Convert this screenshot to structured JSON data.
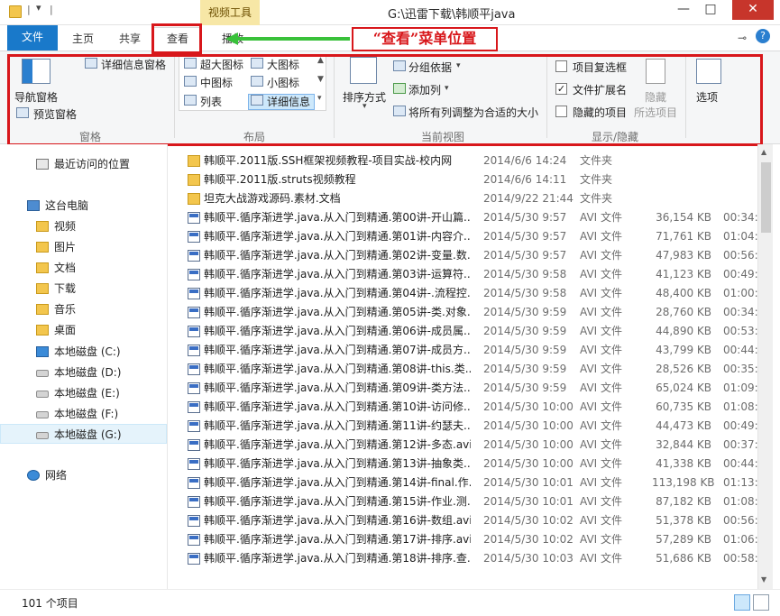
{
  "window": {
    "title": "G:\\迅雷下载\\韩顺平java",
    "context_tab": "视频工具",
    "controls": [
      "—",
      "□",
      "✕"
    ]
  },
  "ribbon_tabs": [
    "文件",
    "主页",
    "共享",
    "查看",
    "播放"
  ],
  "annotation": "“查看”菜单位置",
  "ribbon": {
    "panes": {
      "nav_pane": "导航窗格",
      "preview_pane": "预览窗格",
      "details_pane": "详细信息窗格",
      "label": "窗格"
    },
    "layout": {
      "items": [
        "超大图标",
        "大图标",
        "中图标",
        "小图标",
        "列表",
        "详细信息"
      ],
      "label": "布局"
    },
    "current_view": {
      "sort_by": "排序方式",
      "group_by": "分组依据",
      "add_columns": "添加列",
      "fit_columns": "将所有列调整为合适的大小",
      "label": "当前视图"
    },
    "show_hide": {
      "item_checkboxes": "项目复选框",
      "file_extensions": "文件扩展名",
      "hidden_items": "隐藏的项目",
      "hide": "隐藏",
      "selected_items": "所选项目",
      "label": "显示/隐藏"
    },
    "options": "选项"
  },
  "nav": {
    "items": [
      {
        "label": "最近访问的位置",
        "icon": "recent-places-icon"
      },
      {
        "label": "这台电脑",
        "icon": "this-pc-icon"
      },
      {
        "label": "视频",
        "icon": "folder-icon"
      },
      {
        "label": "图片",
        "icon": "folder-icon"
      },
      {
        "label": "文档",
        "icon": "folder-icon"
      },
      {
        "label": "下载",
        "icon": "folder-icon"
      },
      {
        "label": "音乐",
        "icon": "folder-icon"
      },
      {
        "label": "桌面",
        "icon": "folder-icon"
      },
      {
        "label": "本地磁盘 (C:)",
        "icon": "system-drive-icon"
      },
      {
        "label": "本地磁盘 (D:)",
        "icon": "drive-icon"
      },
      {
        "label": "本地磁盘 (E:)",
        "icon": "drive-icon"
      },
      {
        "label": "本地磁盘 (F:)",
        "icon": "drive-icon"
      },
      {
        "label": "本地磁盘 (G:)",
        "icon": "drive-icon"
      },
      {
        "label": "网络",
        "icon": "network-icon"
      }
    ]
  },
  "files": [
    {
      "name": "韩顺平.2011版.SSH框架视频教程-项目实战-校内网",
      "date": "2014/6/6 14:24",
      "type": "文件夹",
      "size": "",
      "length": "",
      "kind": "folder"
    },
    {
      "name": "韩顺平.2011版.struts视频教程",
      "date": "2014/6/6 14:11",
      "type": "文件夹",
      "size": "",
      "length": "",
      "kind": "folder"
    },
    {
      "name": "坦克大战游戏源码.素材.文档",
      "date": "2014/9/22 21:44",
      "type": "文件夹",
      "size": "",
      "length": "",
      "kind": "folder"
    },
    {
      "name": "韩顺平.循序渐进学.java.从入门到精通.第00讲-开山篇...",
      "date": "2014/5/30 9:57",
      "type": "AVI 文件",
      "size": "36,154 KB",
      "length": "00:34:",
      "kind": "avi"
    },
    {
      "name": "韩顺平.循序渐进学.java.从入门到精通.第01讲-内容介...",
      "date": "2014/5/30 9:57",
      "type": "AVI 文件",
      "size": "71,761 KB",
      "length": "01:04:",
      "kind": "avi"
    },
    {
      "name": "韩顺平.循序渐进学.java.从入门到精通.第02讲-变量.数...",
      "date": "2014/5/30 9:57",
      "type": "AVI 文件",
      "size": "47,983 KB",
      "length": "00:56:",
      "kind": "avi"
    },
    {
      "name": "韩顺平.循序渐进学.java.从入门到精通.第03讲-运算符...",
      "date": "2014/5/30 9:58",
      "type": "AVI 文件",
      "size": "41,123 KB",
      "length": "00:49:",
      "kind": "avi"
    },
    {
      "name": "韩顺平.循序渐进学.java.从入门到精通.第04讲-.流程控...",
      "date": "2014/5/30 9:58",
      "type": "AVI 文件",
      "size": "48,400 KB",
      "length": "01:00:",
      "kind": "avi"
    },
    {
      "name": "韩顺平.循序渐进学.java.从入门到精通.第05讲-类.对象...",
      "date": "2014/5/30 9:59",
      "type": "AVI 文件",
      "size": "28,760 KB",
      "length": "00:34:",
      "kind": "avi"
    },
    {
      "name": "韩顺平.循序渐进学.java.从入门到精通.第06讲-成员属...",
      "date": "2014/5/30 9:59",
      "type": "AVI 文件",
      "size": "44,890 KB",
      "length": "00:53:",
      "kind": "avi"
    },
    {
      "name": "韩顺平.循序渐进学.java.从入门到精通.第07讲-成员方...",
      "date": "2014/5/30 9:59",
      "type": "AVI 文件",
      "size": "43,799 KB",
      "length": "00:44:",
      "kind": "avi"
    },
    {
      "name": "韩顺平.循序渐进学.java.从入门到精通.第08讲-this.类...",
      "date": "2014/5/30 9:59",
      "type": "AVI 文件",
      "size": "28,526 KB",
      "length": "00:35:",
      "kind": "avi"
    },
    {
      "name": "韩顺平.循序渐进学.java.从入门到精通.第09讲-类方法...",
      "date": "2014/5/30 9:59",
      "type": "AVI 文件",
      "size": "65,024 KB",
      "length": "01:09:",
      "kind": "avi"
    },
    {
      "name": "韩顺平.循序渐进学.java.从入门到精通.第10讲-访问修...",
      "date": "2014/5/30 10:00",
      "type": "AVI 文件",
      "size": "60,735 KB",
      "length": "01:08:",
      "kind": "avi"
    },
    {
      "name": "韩顺平.循序渐进学.java.从入门到精通.第11讲-约瑟夫...",
      "date": "2014/5/30 10:00",
      "type": "AVI 文件",
      "size": "44,473 KB",
      "length": "00:49:",
      "kind": "avi"
    },
    {
      "name": "韩顺平.循序渐进学.java.从入门到精通.第12讲-多态.avi",
      "date": "2014/5/30 10:00",
      "type": "AVI 文件",
      "size": "32,844 KB",
      "length": "00:37:",
      "kind": "avi"
    },
    {
      "name": "韩顺平.循序渐进学.java.从入门到精通.第13讲-抽象类...",
      "date": "2014/5/30 10:00",
      "type": "AVI 文件",
      "size": "41,338 KB",
      "length": "00:44:",
      "kind": "avi"
    },
    {
      "name": "韩顺平.循序渐进学.java.从入门到精通.第14讲-final.作...",
      "date": "2014/5/30 10:01",
      "type": "AVI 文件",
      "size": "113,198 KB",
      "length": "01:13:",
      "kind": "avi"
    },
    {
      "name": "韩顺平.循序渐进学.java.从入门到精通.第15讲-作业.测...",
      "date": "2014/5/30 10:01",
      "type": "AVI 文件",
      "size": "87,182 KB",
      "length": "01:08:",
      "kind": "avi"
    },
    {
      "name": "韩顺平.循序渐进学.java.从入门到精通.第16讲-数组.avi",
      "date": "2014/5/30 10:02",
      "type": "AVI 文件",
      "size": "51,378 KB",
      "length": "00:56:",
      "kind": "avi"
    },
    {
      "name": "韩顺平.循序渐进学.java.从入门到精通.第17讲-排序.avi",
      "date": "2014/5/30 10:02",
      "type": "AVI 文件",
      "size": "57,289 KB",
      "length": "01:06:",
      "kind": "avi"
    },
    {
      "name": "韩顺平.循序渐进学.java.从入门到精通.第18讲-排序.查...",
      "date": "2014/5/30 10:03",
      "type": "AVI 文件",
      "size": "51,686 KB",
      "length": "00:58:",
      "kind": "avi"
    }
  ],
  "status": {
    "count": "101 个项目"
  }
}
